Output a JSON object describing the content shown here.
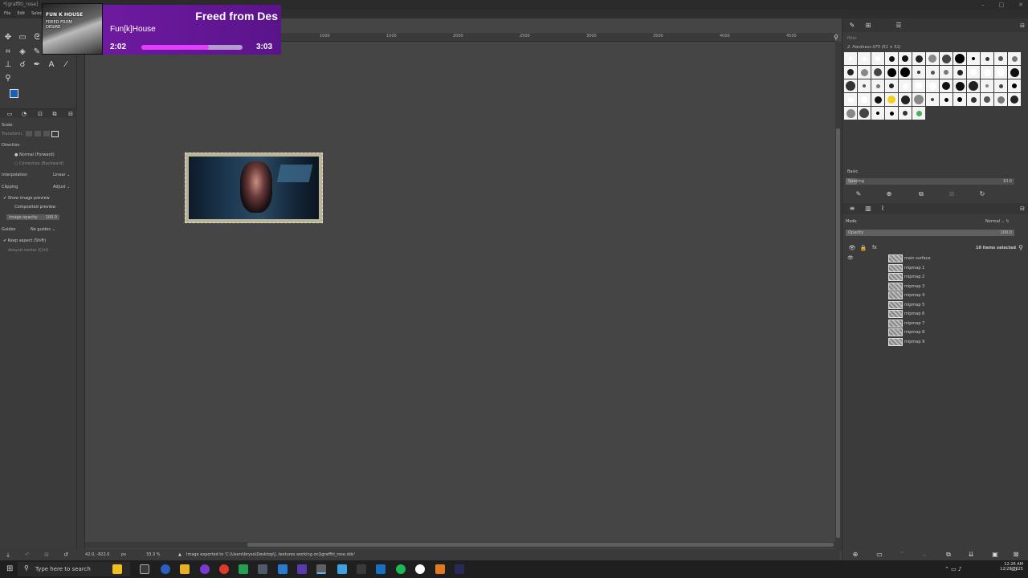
{
  "window": {
    "title": "*[graffiti_rose]",
    "controls": [
      "–",
      "□",
      "✕"
    ]
  },
  "menu": [
    "File",
    "Edit",
    "Select"
  ],
  "tool_options": {
    "title": "Scale",
    "transform_label": "Transform:",
    "direction_label": "Direction",
    "direction_options": [
      "Normal (Forward)",
      "Corrective (Backward)"
    ],
    "interpolation_label": "Interpolation",
    "interpolation_value": "Linear",
    "clipping_label": "Clipping",
    "clipping_value": "Adjust",
    "show_preview": "Show image preview",
    "composited_preview": "Composited preview",
    "image_opacity_label": "Image opacity",
    "image_opacity_value": "100.0",
    "guides_label": "Guides",
    "guides_value": "No guides",
    "keep_aspect": "Keep aspect (Shift)",
    "around_center": "Around center (Ctrl)"
  },
  "ruler": {
    "h_ticks": [
      "1000",
      "1500",
      "2000",
      "2500",
      "3000",
      "3500",
      "4000",
      "4500"
    ]
  },
  "status": {
    "coords": "42.0, -822.0",
    "unit": "px",
    "zoom": "33.3 %",
    "message": "Image exported to 'C:\\Users\\bryso\\Desktop\\[..textures working on]\\graffiti_rose.dds'"
  },
  "brushes": {
    "filter_placeholder": "filter",
    "current_brush": "2. Hardness 075 (51 × 51)",
    "preset": "Basic.",
    "spacing_label": "Spacing",
    "spacing_value": "10.0"
  },
  "layers": {
    "mode_label": "Mode",
    "mode_value": "Normal",
    "opacity_label": "Opacity",
    "opacity_value": "100.0",
    "selected_count": "10 items selected",
    "items": [
      "main surface",
      "mipmap 1",
      "mipmap 2",
      "mipmap 3",
      "mipmap 4",
      "mipmap 5",
      "mipmap 6",
      "mipmap 7",
      "mipmap 8",
      "mipmap 9"
    ]
  },
  "overlay": {
    "song_title": "Freed from Des",
    "artist": "Fun[k]House",
    "elapsed": "2:02",
    "total": "3:03",
    "progress": 0.67,
    "art_label_1": "FUN K HOUSE",
    "art_label_2": "FREED FROM DESIRE"
  },
  "taskbar": {
    "search_placeholder": "Type here to search",
    "time": "12:26 AM",
    "date": "12/28/2025"
  },
  "colors": {
    "fg": "#1a5fb4",
    "bg": "#f0f0f0",
    "accent": "#7a1fb0",
    "progress": "#e040fb"
  }
}
